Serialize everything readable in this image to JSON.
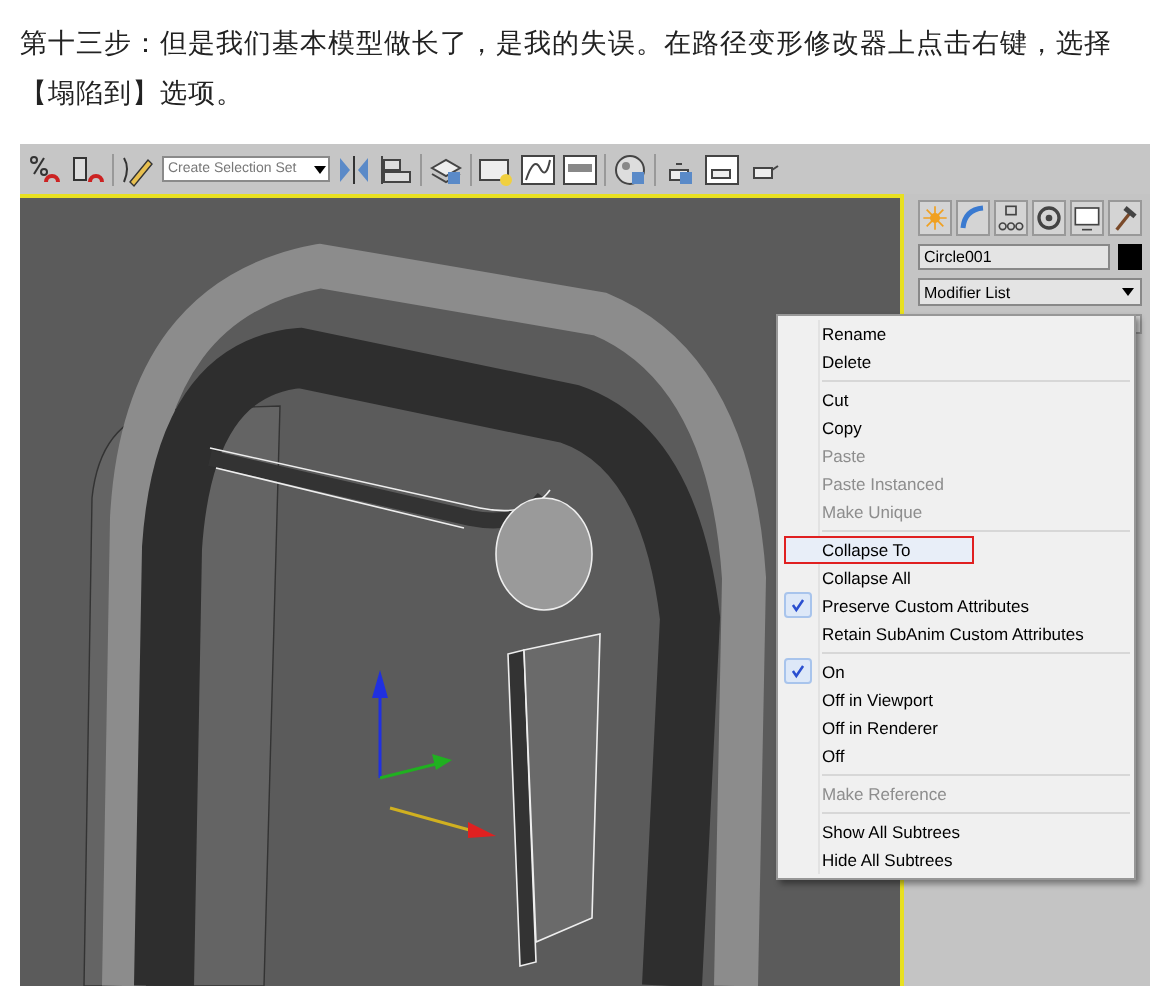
{
  "instruction": "第十三步：但是我们基本模型做长了，是我的失误。在路径变形修改器上点击右键，选择【塌陷到】选项。",
  "toolbar": {
    "selection_set": "Create Selection Set"
  },
  "command_panel": {
    "object_name": "Circle001",
    "modifier_list": "Modifier List"
  },
  "context_menu": {
    "groups": [
      [
        {
          "label": "Rename",
          "disabled": false,
          "checked": false,
          "annotated": false
        },
        {
          "label": "Delete",
          "disabled": false,
          "checked": false,
          "annotated": false
        }
      ],
      [
        {
          "label": "Cut",
          "disabled": false,
          "checked": false,
          "annotated": false
        },
        {
          "label": "Copy",
          "disabled": false,
          "checked": false,
          "annotated": false
        },
        {
          "label": "Paste",
          "disabled": true,
          "checked": false,
          "annotated": false
        },
        {
          "label": "Paste Instanced",
          "disabled": true,
          "checked": false,
          "annotated": false
        },
        {
          "label": "Make Unique",
          "disabled": true,
          "checked": false,
          "annotated": false
        }
      ],
      [
        {
          "label": "Collapse To",
          "disabled": false,
          "checked": false,
          "annotated": true
        },
        {
          "label": "Collapse All",
          "disabled": false,
          "checked": false,
          "annotated": false
        },
        {
          "label": "Preserve Custom Attributes",
          "disabled": false,
          "checked": true,
          "annotated": false
        },
        {
          "label": "Retain SubAnim Custom Attributes",
          "disabled": false,
          "checked": false,
          "annotated": false
        }
      ],
      [
        {
          "label": "On",
          "disabled": false,
          "checked": true,
          "annotated": false
        },
        {
          "label": "Off in Viewport",
          "disabled": false,
          "checked": false,
          "annotated": false
        },
        {
          "label": "Off in Renderer",
          "disabled": false,
          "checked": false,
          "annotated": false
        },
        {
          "label": "Off",
          "disabled": false,
          "checked": false,
          "annotated": false
        }
      ],
      [
        {
          "label": "Make Reference",
          "disabled": true,
          "checked": false,
          "annotated": false
        }
      ],
      [
        {
          "label": "Show All Subtrees",
          "disabled": false,
          "checked": false,
          "annotated": false
        },
        {
          "label": "Hide All Subtrees",
          "disabled": false,
          "checked": false,
          "annotated": false
        }
      ]
    ]
  }
}
